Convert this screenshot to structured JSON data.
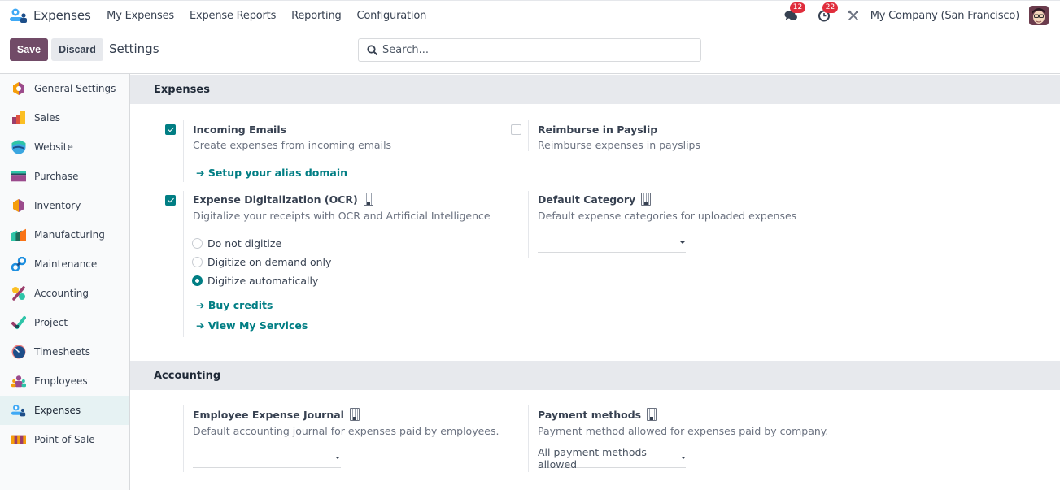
{
  "navbar": {
    "app_name": "Expenses",
    "menu": [
      "My Expenses",
      "Expense Reports",
      "Reporting",
      "Configuration"
    ],
    "messages_badge": "12",
    "activities_badge": "22",
    "company": "My Company (San Francisco)",
    "icons": {
      "app": "expenses-app-icon",
      "messages": "chat-icon",
      "activities": "clock-icon",
      "debug": "tools-icon",
      "user": "user-avatar"
    }
  },
  "controlbar": {
    "save_label": "Save",
    "discard_label": "Discard",
    "page_title": "Settings",
    "search_placeholder": "Search..."
  },
  "sidebar": {
    "items": [
      {
        "label": "General Settings",
        "icon": "general-settings-icon",
        "active": false
      },
      {
        "label": "Sales",
        "icon": "sales-icon",
        "active": false
      },
      {
        "label": "Website",
        "icon": "website-icon",
        "active": false
      },
      {
        "label": "Purchase",
        "icon": "purchase-icon",
        "active": false
      },
      {
        "label": "Inventory",
        "icon": "inventory-icon",
        "active": false
      },
      {
        "label": "Manufacturing",
        "icon": "manufacturing-icon",
        "active": false
      },
      {
        "label": "Maintenance",
        "icon": "maintenance-icon",
        "active": false
      },
      {
        "label": "Accounting",
        "icon": "accounting-icon",
        "active": false
      },
      {
        "label": "Project",
        "icon": "project-icon",
        "active": false
      },
      {
        "label": "Timesheets",
        "icon": "timesheets-icon",
        "active": false
      },
      {
        "label": "Employees",
        "icon": "employees-icon",
        "active": false
      },
      {
        "label": "Expenses",
        "icon": "expenses-icon",
        "active": true
      },
      {
        "label": "Point of Sale",
        "icon": "point-of-sale-icon",
        "active": false
      }
    ]
  },
  "sections": {
    "expenses": {
      "title": "Expenses",
      "incoming_emails": {
        "title": "Incoming Emails",
        "desc": "Create expenses from incoming emails",
        "checked": true,
        "link": "➔ Setup your alias domain"
      },
      "reimburse_payslip": {
        "title": "Reimburse in Payslip",
        "desc": "Reimburse expenses in payslips",
        "checked": false
      },
      "ocr": {
        "title": "Expense Digitalization (OCR)",
        "desc": "Digitalize your receipts with OCR and Artificial Intelligence",
        "checked": true,
        "options": [
          "Do not digitize",
          "Digitize on demand only",
          "Digitize automatically"
        ],
        "selected": "Digitize automatically",
        "link_buy": "➔ Buy credits",
        "link_services": "➔ View My Services"
      },
      "default_category": {
        "title": "Default Category",
        "desc": "Default expense categories for uploaded expenses",
        "value": ""
      }
    },
    "accounting": {
      "title": "Accounting",
      "journal": {
        "title": "Employee Expense Journal",
        "desc": "Default accounting journal for expenses paid by employees.",
        "value": ""
      },
      "payment_methods": {
        "title": "Payment methods",
        "desc": "Payment method allowed for expenses paid by company.",
        "value": "All payment methods allowed"
      }
    }
  },
  "colors": {
    "primary": "#714b67",
    "accent": "#017e84",
    "badge": "#e02d3c"
  }
}
